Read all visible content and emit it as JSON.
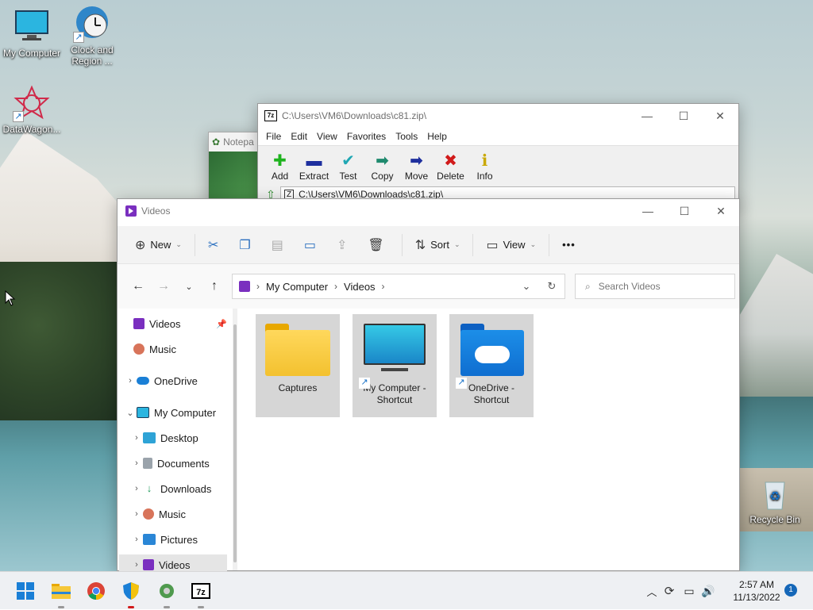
{
  "desktop": {
    "icons": [
      {
        "label": "My Computer",
        "icon": "monitor-icon"
      },
      {
        "label": "Clock and Region ...",
        "icon": "clock-globe-icon"
      },
      {
        "label": "DataWagon...",
        "icon": "datawagon-icon"
      },
      {
        "label": "Recycle Bin",
        "icon": "recycle-bin-icon"
      }
    ]
  },
  "notepad": {
    "title": "Notepa"
  },
  "sevenzip": {
    "title": "C:\\Users\\VM6\\Downloads\\c81.zip\\",
    "app_icon": "7z",
    "menu": [
      "File",
      "Edit",
      "View",
      "Favorites",
      "Tools",
      "Help"
    ],
    "toolbar": [
      {
        "label": "Add",
        "icon": "add-icon",
        "color": "#1eb31e"
      },
      {
        "label": "Extract",
        "icon": "extract-icon",
        "color": "#1e2f9e"
      },
      {
        "label": "Test",
        "icon": "test-icon",
        "color": "#1fa7b3"
      },
      {
        "label": "Copy",
        "icon": "copy-arrow-icon",
        "color": "#1f8a6e"
      },
      {
        "label": "Move",
        "icon": "move-arrow-icon",
        "color": "#1e2f9e"
      },
      {
        "label": "Delete",
        "icon": "delete-icon",
        "color": "#d11a1a"
      },
      {
        "label": "Info",
        "icon": "info-icon",
        "color": "#c9a800"
      }
    ],
    "address": "C:\\Users\\VM6\\Downloads\\c81.zip\\"
  },
  "explorer": {
    "title": "Videos",
    "cmdbar": {
      "new_label": "New",
      "sort_label": "Sort",
      "view_label": "View",
      "more": "•••"
    },
    "address": {
      "segments": [
        "My Computer",
        "Videos"
      ]
    },
    "search": {
      "placeholder": "Search Videos"
    },
    "sidebar": [
      {
        "label": "Videos",
        "icon": "videos-icon",
        "pinned": true,
        "expander": ""
      },
      {
        "label": "Music",
        "icon": "music-icon",
        "pinned": false,
        "expander": ""
      },
      {
        "label": "OneDrive",
        "icon": "onedrive-icon",
        "pinned": false,
        "expander": "›"
      },
      {
        "label": "My Computer",
        "icon": "computer-icon",
        "pinned": false,
        "expander": "⌄"
      },
      {
        "label": "Desktop",
        "icon": "desktop-icon",
        "pinned": false,
        "expander": "›"
      },
      {
        "label": "Documents",
        "icon": "documents-icon",
        "pinned": false,
        "expander": "›"
      },
      {
        "label": "Downloads",
        "icon": "downloads-icon",
        "pinned": false,
        "expander": "›"
      },
      {
        "label": "Music",
        "icon": "music-icon",
        "pinned": false,
        "expander": "›"
      },
      {
        "label": "Pictures",
        "icon": "pictures-icon",
        "pinned": false,
        "expander": "›"
      },
      {
        "label": "Videos",
        "icon": "videos-icon",
        "pinned": false,
        "expander": "›",
        "selected": true
      }
    ],
    "items": [
      {
        "name": "Captures",
        "icon": "folder-icon",
        "shortcut": false
      },
      {
        "name": "My Computer - Shortcut",
        "icon": "monitor-icon",
        "shortcut": true
      },
      {
        "name": "OneDrive - Shortcut",
        "icon": "onedrive-folder-icon",
        "shortcut": true
      }
    ]
  },
  "taskbar": {
    "apps": [
      "start-icon",
      "file-explorer-icon",
      "chrome-icon",
      "security-shield-icon",
      "datawagon-icon",
      "7zip-icon"
    ],
    "clock": {
      "time": "2:57 AM",
      "date": "11/13/2022"
    },
    "notification_count": "1"
  }
}
